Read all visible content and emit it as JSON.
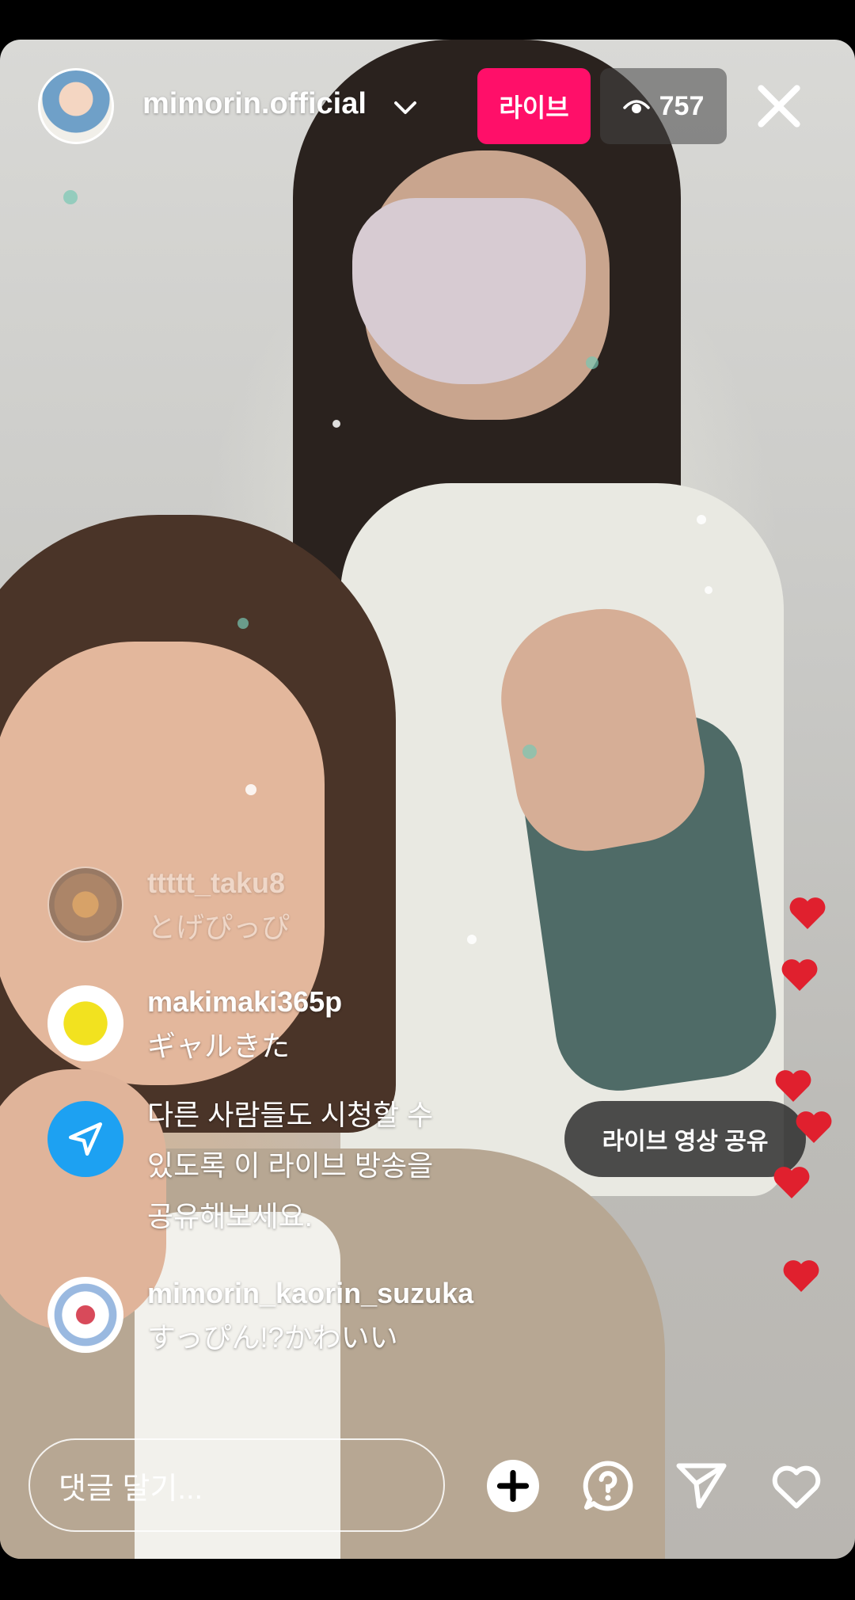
{
  "header": {
    "username": "mimorin.official",
    "live_label": "라이브",
    "viewer_count": "757"
  },
  "comments": [
    {
      "user": "ttttt_taku8",
      "text": "とげぴっぴ"
    },
    {
      "user": "makimaki365p",
      "text": "ギャルきた"
    },
    {
      "user": "mimorin_kaorin_suzuka",
      "text": "すっぴん!?かわいい"
    }
  ],
  "share_prompt": {
    "line1": "다른 사람들도 시청할 수",
    "line2": "있도록 이 라이브 방송을",
    "line3": "공유해보세요."
  },
  "share_button_label": "라이브 영상 공유",
  "comment_input": {
    "placeholder": "댓글 달기..."
  },
  "colors": {
    "live_badge": "#ff0f69",
    "share_icon_bg": "#1da1f2",
    "heart": "#e0202e"
  },
  "icons": [
    "chevron-down-icon",
    "eye-icon",
    "close-icon",
    "send-icon",
    "add-icon",
    "question-icon",
    "heart-icon"
  ]
}
